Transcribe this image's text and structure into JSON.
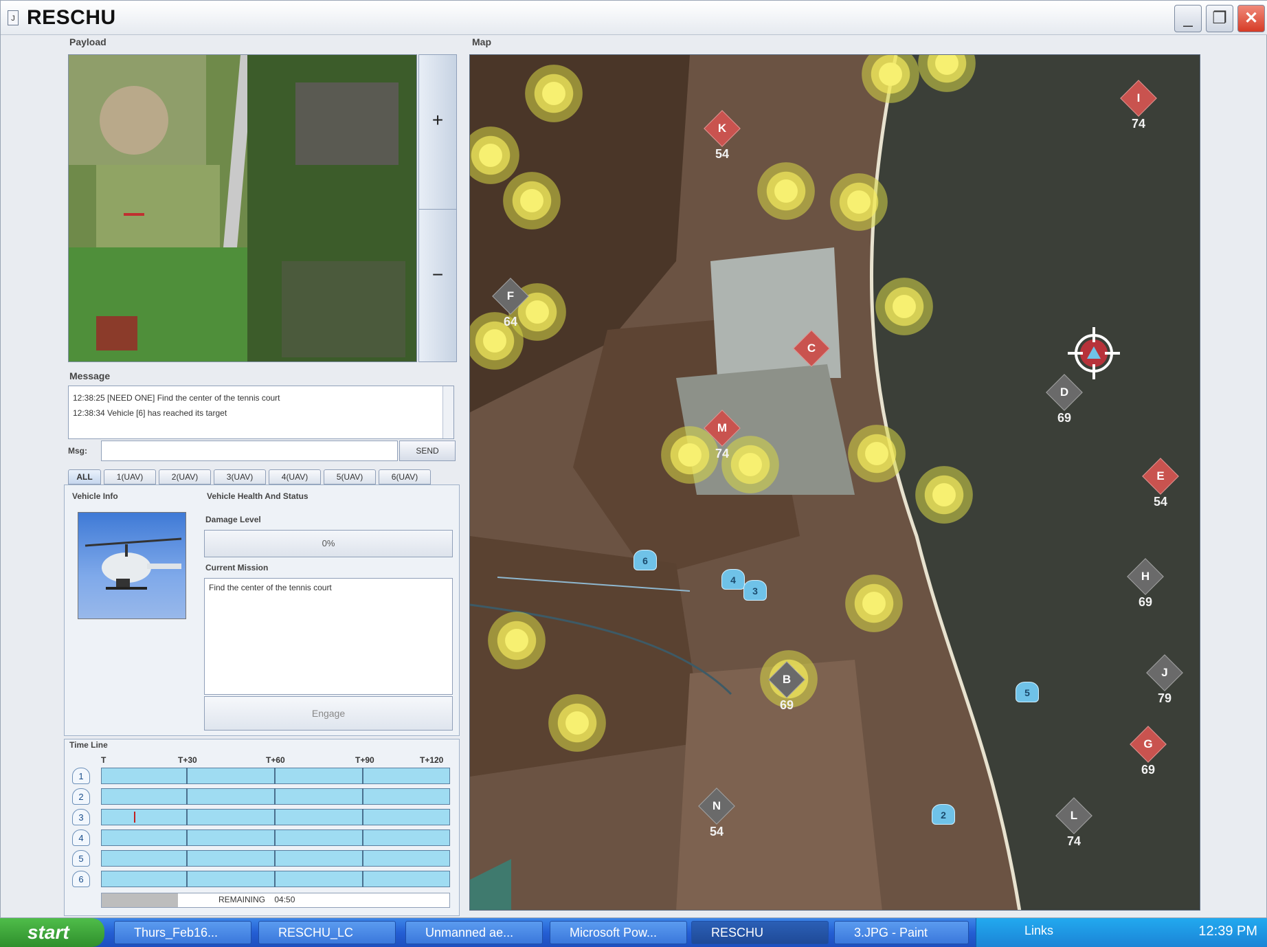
{
  "window": {
    "title": "RESCHU"
  },
  "sections": {
    "payload": "Payload",
    "map": "Map",
    "message": "Message",
    "timeline": "Time Line"
  },
  "payload": {
    "zoom_in": "+",
    "zoom_out": "−"
  },
  "message": {
    "lines": [
      "12:38:25  [NEED ONE] Find the center of the tennis court",
      "12:38:34  Vehicle [6] has reached its target"
    ],
    "input_label": "Msg:",
    "input_value": "",
    "send_label": "SEND"
  },
  "tabs": [
    "ALL",
    "1(UAV)",
    "2(UAV)",
    "3(UAV)",
    "4(UAV)",
    "5(UAV)",
    "6(UAV)"
  ],
  "vehicle": {
    "info_label": "Vehicle Info",
    "health_label": "Vehicle Health And Status",
    "damage_label": "Damage Level",
    "damage_value": "0%",
    "mission_label": "Current Mission",
    "mission_text": "Find the center of the tennis court",
    "engage_label": "Engage"
  },
  "timeline": {
    "ticks": [
      "T",
      "T+30",
      "T+60",
      "T+90",
      "T+120"
    ],
    "rows": [
      "1",
      "2",
      "3",
      "4",
      "5",
      "6"
    ],
    "remaining_label": "REMAINING",
    "remaining_value": "04:50",
    "remaining_fraction": 0.22
  },
  "map": {
    "targets": [
      {
        "letter": "K",
        "value": "54",
        "color": "#c9534f"
      },
      {
        "letter": "I",
        "value": "74",
        "color": "#c9534f"
      },
      {
        "letter": "F",
        "value": "64",
        "color": "#6a6a6a"
      },
      {
        "letter": "C",
        "value": "",
        "color": "#c9534f"
      },
      {
        "letter": "D",
        "value": "69",
        "color": "#6a6a6a"
      },
      {
        "letter": "M",
        "value": "74",
        "color": "#c9534f"
      },
      {
        "letter": "E",
        "value": "54",
        "color": "#c9534f"
      },
      {
        "letter": "H",
        "value": "69",
        "color": "#6a6a6a"
      },
      {
        "letter": "B",
        "value": "69",
        "color": "#6a6a6a"
      },
      {
        "letter": "J",
        "value": "79",
        "color": "#6a6a6a"
      },
      {
        "letter": "G",
        "value": "69",
        "color": "#c9534f"
      },
      {
        "letter": "N",
        "value": "54",
        "color": "#6a6a6a"
      },
      {
        "letter": "L",
        "value": "74",
        "color": "#6a6a6a"
      }
    ],
    "uavs": [
      "6",
      "4",
      "3",
      "5",
      "2"
    ]
  },
  "taskbar": {
    "start_label": "start",
    "items": [
      "Thurs_Feb16...",
      "RESCHU_LC",
      "Unmanned ae...",
      "Microsoft Pow...",
      "RESCHU",
      "3.JPG - Paint"
    ],
    "tray_text": "Links",
    "clock": "12:39 PM"
  }
}
